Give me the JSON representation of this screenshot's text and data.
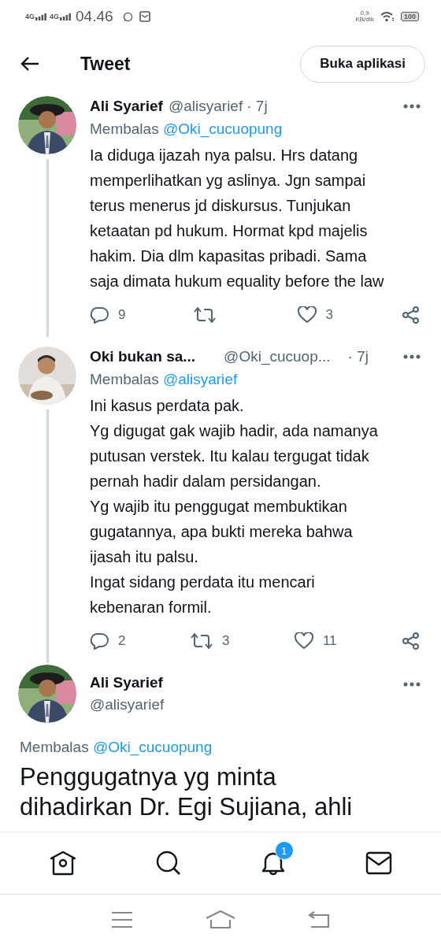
{
  "status_bar": {
    "network": [
      "4G",
      "4G"
    ],
    "time": "04.46",
    "speed": "0,9",
    "speed_unit": "KB/dtk",
    "battery": "100"
  },
  "top_bar": {
    "title": "Tweet",
    "button": "Buka aplikasi"
  },
  "replies": [
    {
      "name": "Ali Syarief",
      "handle": "@alisyarief",
      "time": "· 7j",
      "replying_label": "Membalas",
      "replying_to": "@Oki_cucuopung",
      "paragraphs": [
        "Ia diduga ijazah nya palsu. Hrs datang memperlihatkan yg aslinya. Jgn sampai terus menerus jd diskursus. Tunjukan ketaatan pd hukum. Hormat kpd majelis hakim. Dia dlm kapasitas pribadi. Sama saja dimata hukum equality before the law"
      ],
      "reply_count": "9",
      "like_count": "3"
    },
    {
      "name": "Oki bukan sa...",
      "handle": "@Oki_cucuop...",
      "time": "· 7j",
      "replying_label": "Membalas",
      "replying_to": "@alisyarief",
      "paragraphs": [
        "Ini kasus perdata pak.",
        "Yg digugat gak wajib hadir, ada namanya putusan verstek. Itu kalau tergugat tidak pernah hadir dalam persidangan.",
        "Yg wajib itu penggugat membuktikan gugatannya, apa bukti mereka bahwa ijasah itu palsu.",
        "Ingat sidang perdata itu mencari kebenaran formil."
      ],
      "reply_count": "2",
      "retweet_count": "3",
      "like_count": "11"
    }
  ],
  "main_tweet": {
    "name": "Ali Syarief",
    "handle": "@alisyarief",
    "replying_label": "Membalas",
    "replying_to": "@Oki_cucuopung",
    "text": "Penggugatnya yg minta dihadirkan Dr. Egi Sujiana, ahli"
  },
  "bottom_nav": {
    "notification_badge": "1"
  }
}
